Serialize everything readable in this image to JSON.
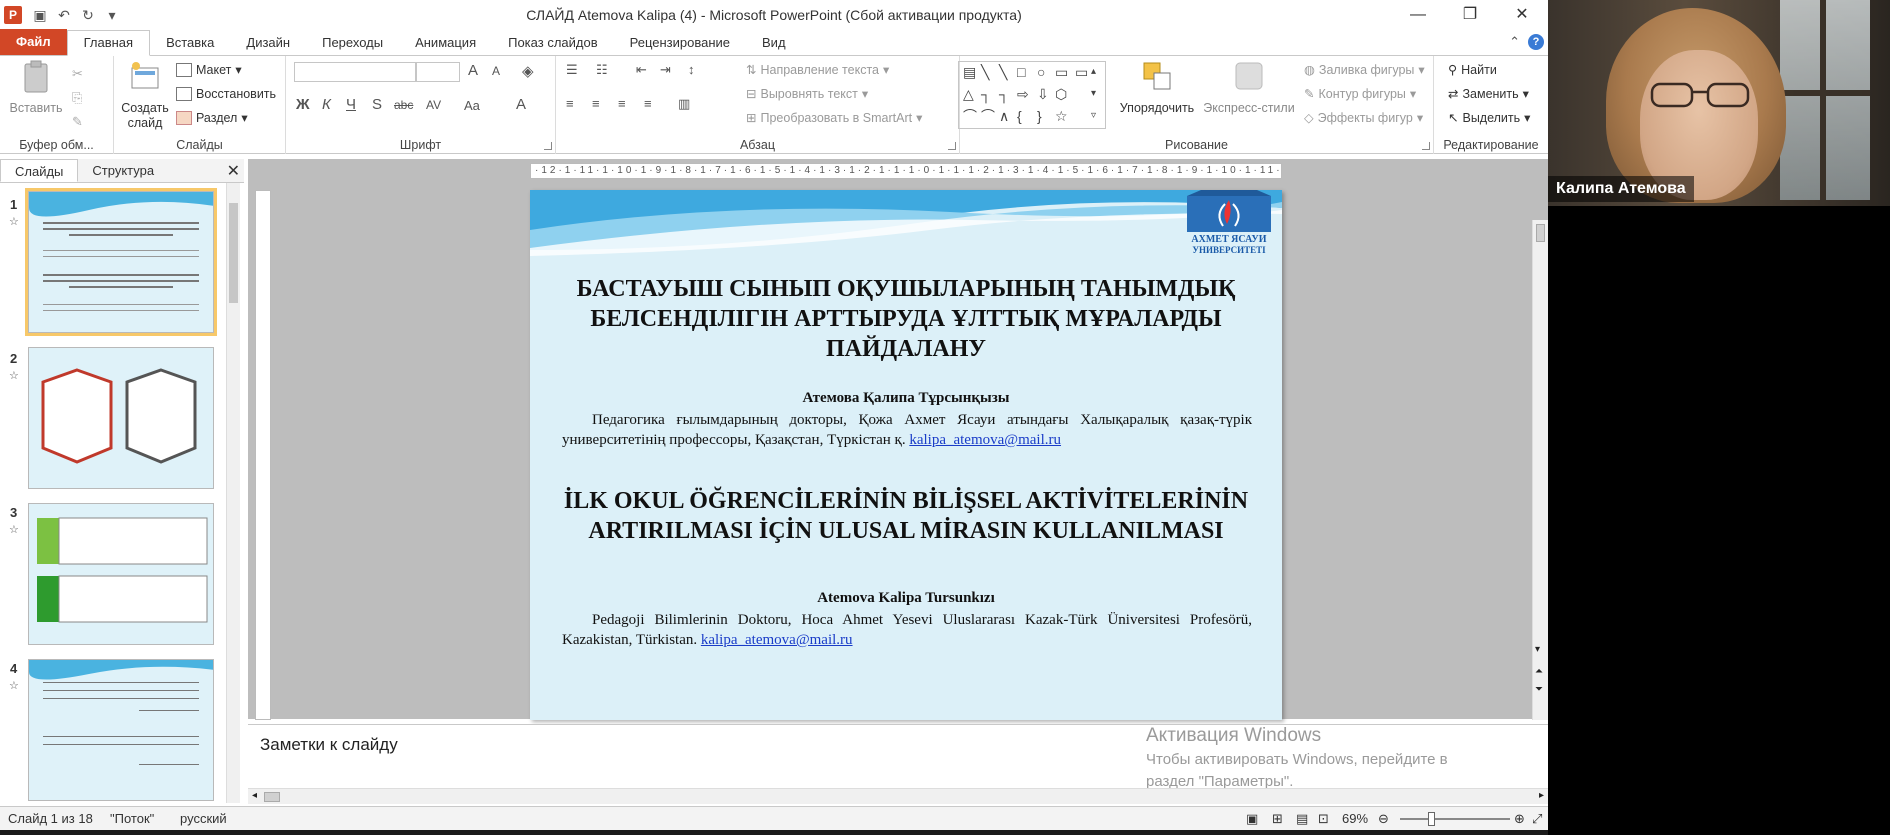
{
  "window": {
    "title": "СЛАЙД Atemova Kalipa (4)  -  Microsoft PowerPoint (Сбой активации продукта)",
    "app_letter": "P",
    "controls": [
      "—",
      "❐",
      "✕"
    ]
  },
  "ribbon_tabs": {
    "file": "Файл",
    "items": [
      "Главная",
      "Вставка",
      "Дизайн",
      "Переходы",
      "Анимация",
      "Показ слайдов",
      "Рецензирование",
      "Вид"
    ]
  },
  "ribbon": {
    "clipboard": {
      "label": "Буфер обм...",
      "paste": "Вставить"
    },
    "slides": {
      "label": "Слайды",
      "new_slide": "Создать слайд",
      "layout": "Макет",
      "reset": "Восстановить",
      "section": "Раздел"
    },
    "font": {
      "label": "Шрифт",
      "bold": "Ж",
      "italic": "К",
      "underline": "Ч",
      "strike": "S",
      "abc": "abc",
      "spacing": "AV",
      "case": "Aa",
      "grow": "A",
      "shrink": "A"
    },
    "paragraph": {
      "label": "Абзац",
      "text_direction": "Направление текста",
      "align_text": "Выровнять текст",
      "convert_smartart": "Преобразовать в SmartArt"
    },
    "drawing": {
      "label": "Рисование",
      "arrange": "Упорядочить",
      "quick_styles": "Экспресс-стили",
      "shape_fill": "Заливка фигуры",
      "shape_outline": "Контур фигуры",
      "shape_effects": "Эффекты фигур"
    },
    "editing": {
      "label": "Редактирование",
      "find": "Найти",
      "replace": "Заменить",
      "select": "Выделить"
    }
  },
  "left_pane": {
    "tabs": [
      "Слайды",
      "Структура"
    ],
    "close": "✕",
    "thumbs": [
      {
        "num": "1"
      },
      {
        "num": "2"
      },
      {
        "num": "3"
      },
      {
        "num": "4"
      }
    ]
  },
  "ruler": {
    "text": "·12·1·11·1·10·1·9·1·8·1·7·1·6·1·5·1·4·1·3·1·2·1·1·1·0·1·1·1·2·1·3·1·4·1·5·1·6·1·7·1·8·1·9·1·10·1·11·1·12·"
  },
  "slide": {
    "logo_line1": "АХМЕТ ЯСАУИ",
    "logo_line2": "УНИВЕРСИТЕТІ",
    "title_kz": "БАСТАУЫШ СЫНЫП ОҚУШЫЛАРЫНЫҢ ТАНЫМДЫҚ БЕЛСЕНДІЛІГІН АРТТЫРУДА ҰЛТТЫҚ МҰРАЛАРДЫ ПАЙДАЛАНУ",
    "author_kz": "Атемова Қалипа Тұрсынқызы",
    "affil_kz": "Педагогика ғылымдарының докторы, Қожа Ахмет Ясауи атындағы Халықаралық қазақ-түрік университетінің профессоры, Қазақстан, Түркістан қ.",
    "email_kz": "kalipa_atemova@mail.ru",
    "title_tr": "İLK OKUL ÖĞRENCİLERİNİN BİLİŞSEL AKTİVİTELERİNİN ARTIRILMASI İÇİN ULUSAL MİRASIN KULLANILMASI",
    "author_tr": "Atemova Kalipa Tursunkızı",
    "affil_tr": "Pedagoji Bilimlerinin Doktoru, Hoca Ahmet Yesevi Uluslararası Kazak-Türk Üniversitesi Profesörü, Kazakistan, Türkistan.",
    "email_tr": " kalipa_atemova@mail.ru"
  },
  "notes": {
    "placeholder": "Заметки к слайду",
    "activation_title": "Активация Windows",
    "activation_text": "Чтобы активировать Windows, перейдите в раздел \"Параметры\"."
  },
  "status": {
    "slide_counter": "Слайд 1 из 18",
    "theme": "\"Поток\"",
    "language": "русский",
    "zoom": "69%",
    "zoom_minus": "⊖",
    "zoom_plus": "⊕"
  },
  "webcam": {
    "name": "Калипа Атемова"
  },
  "colors": {
    "file_tab": "#d24726",
    "slide_bg": "#dcf0f8",
    "link": "#1a3cc8",
    "selected_thumb": "#f7c869"
  }
}
